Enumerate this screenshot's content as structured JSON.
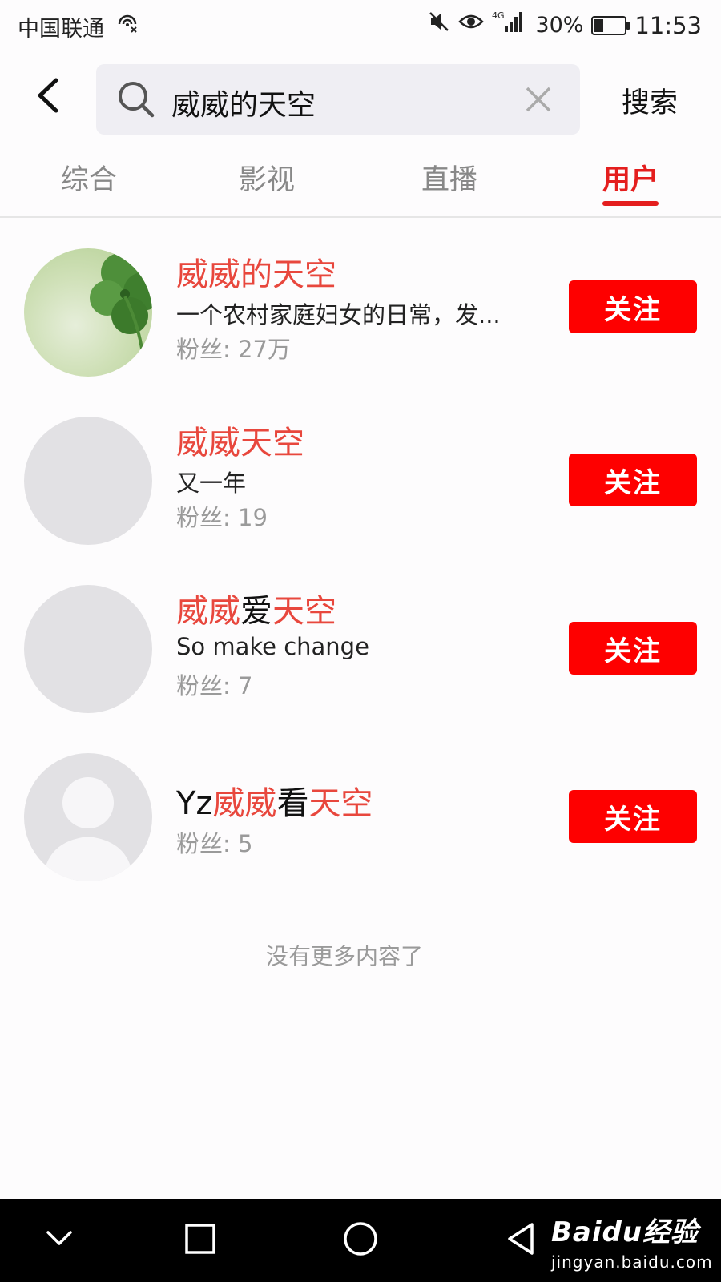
{
  "status_bar": {
    "carrier": "中国联通",
    "network": "4G",
    "battery_percent": "30%",
    "battery_level": 0.3,
    "time": "11:53",
    "icons": [
      "hotspot-icon",
      "mute-icon",
      "eye-icon",
      "signal-icon",
      "battery-icon"
    ]
  },
  "search": {
    "query": "威威的天空",
    "button_label": "搜索"
  },
  "tabs": [
    {
      "label": "综合",
      "active": false
    },
    {
      "label": "影视",
      "active": false
    },
    {
      "label": "直播",
      "active": false
    },
    {
      "label": "用户",
      "active": true
    }
  ],
  "users": [
    {
      "name_parts": [
        {
          "text": "威威的天空",
          "hl": true
        }
      ],
      "description": "一个农村家庭妇女的日常，发...",
      "fans": "粉丝: 27万",
      "avatar": "clover-avatar",
      "follow_label": "关注"
    },
    {
      "name_parts": [
        {
          "text": "威威天空",
          "hl": true
        }
      ],
      "description": "又一年",
      "fans": "粉丝: 19",
      "avatar": "blank-avatar",
      "follow_label": "关注"
    },
    {
      "name_parts": [
        {
          "text": "威威",
          "hl": true
        },
        {
          "text": "爱",
          "hl": false
        },
        {
          "text": "天空",
          "hl": true
        }
      ],
      "description": "So make change",
      "fans": "粉丝: 7",
      "avatar": "blank-avatar",
      "follow_label": "关注"
    },
    {
      "name_parts": [
        {
          "text": "Yz",
          "hl": false
        },
        {
          "text": "威威",
          "hl": true
        },
        {
          "text": "看",
          "hl": false
        },
        {
          "text": "天空",
          "hl": true
        }
      ],
      "description": "",
      "fans": "粉丝: 5",
      "avatar": "default-person-avatar",
      "follow_label": "关注"
    }
  ],
  "no_more_text": "没有更多内容了",
  "colors": {
    "accent": "#e41e1e",
    "highlight": "#e8473d",
    "follow_button": "#fe0000"
  },
  "watermark": {
    "brand": "Baidu经验",
    "url": "jingyan.baidu.com"
  }
}
